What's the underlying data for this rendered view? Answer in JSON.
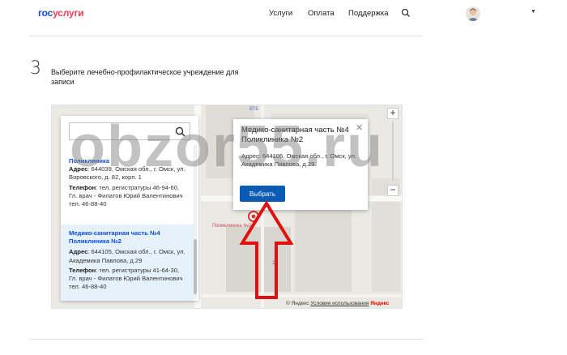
{
  "header": {
    "logo": {
      "part1": "гос",
      "part2": "услуги"
    },
    "nav": [
      "Услуги",
      "Оплата",
      "Поддержка"
    ]
  },
  "step": {
    "number": "3",
    "title": "Выберите лечебно-профилактическое учреждение для записи"
  },
  "search": {
    "value": "",
    "placeholder": ""
  },
  "list": [
    {
      "name": "Поликлиника",
      "address_label": "Адрес",
      "address": ": 644039, Омская обл., г. Омск, ул. Воровского, д. 82, корп. 1",
      "phone_label": "Телефон",
      "phone": ": тел. регистратуры 46-94-60, Гл. врач - Филатов Юрий Валентинович тел. 46-88-40"
    },
    {
      "name": "Медико-санитарная часть №4 Поликлиника №2",
      "address_label": "Адрес",
      "address": ": 644105, Омская обл., г. Омск, ул. Академика Павлова, д.29",
      "phone_label": "Телефон",
      "phone": ": тел. регистратуры 41-64-30, Гл. врач - Филатов Юрий Валентинович тел. 46-88-40"
    }
  ],
  "balloon": {
    "title": "Медико-санитарная часть №4 Поликлиника №2",
    "address": "Адрес: 644105, Омская обл., г. Омск, ул. Академика Павлова, д.29",
    "button": "Выбрать"
  },
  "map": {
    "label_vtb": "ВТБ",
    "label_clinic": "Поликлиника №2",
    "label_house": "29",
    "copyright": "© Яндекс",
    "terms": "Условия использования",
    "brand": "Яндекс"
  },
  "watermark": "obzor55.ru",
  "colors": {
    "brand_blue": "#0d4cd3",
    "brand_red": "#ee3f58",
    "select_bg": "#e6f2fb",
    "button": "#0b5bb5"
  }
}
